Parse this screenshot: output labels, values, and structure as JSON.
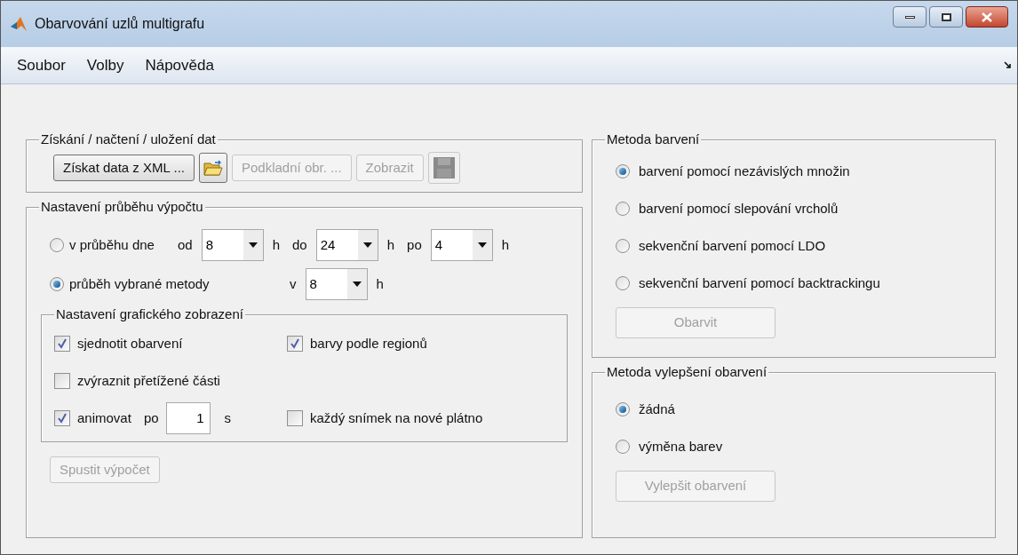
{
  "window": {
    "title": "Obarvování uzlů multigrafu"
  },
  "menu": [
    {
      "label": "Soubor"
    },
    {
      "label": "Volby"
    },
    {
      "label": "Nápověda"
    }
  ],
  "data_group": {
    "title": "Získání / načtení / uložení dat",
    "items": [
      {
        "kind": "button",
        "label": "Získat data z XML ...",
        "disabled": false
      },
      {
        "kind": "folder",
        "disabled": false
      },
      {
        "kind": "button",
        "label": "Podkladní obr. ...",
        "disabled": true
      },
      {
        "kind": "button",
        "label": "Zobrazit",
        "disabled": true
      },
      {
        "kind": "save",
        "disabled": true
      }
    ]
  },
  "calc_group": {
    "title": "Nastavení průběhu výpočtu",
    "options": [
      {
        "label": "v průběhu dne",
        "selected": false,
        "parts": [
          {
            "kind": "text",
            "text": "od"
          },
          {
            "kind": "select",
            "value": "8"
          },
          {
            "kind": "text",
            "text": "h"
          },
          {
            "kind": "text",
            "text": "do"
          },
          {
            "kind": "select",
            "value": "24"
          },
          {
            "kind": "text",
            "text": "h"
          },
          {
            "kind": "text",
            "text": "po"
          },
          {
            "kind": "select",
            "value": "4"
          },
          {
            "kind": "text",
            "text": "h"
          }
        ]
      },
      {
        "label": "průběh vybrané metody",
        "selected": true,
        "parts": [
          {
            "kind": "text",
            "text": "v"
          },
          {
            "kind": "select",
            "value": "8"
          },
          {
            "kind": "text",
            "text": "h"
          }
        ]
      }
    ],
    "graphics_group": {
      "title": "Nastavení grafického zobrazení",
      "rows": [
        [
          {
            "kind": "checkbox",
            "label": "sjednotit obarvení",
            "checked": true
          },
          {
            "kind": "checkbox",
            "label": "barvy podle regionů",
            "checked": true
          }
        ],
        [
          {
            "kind": "checkbox",
            "label": "zvýraznit přetížené části",
            "checked": false
          }
        ],
        [
          {
            "kind": "animate",
            "label": "animovat",
            "checked": true,
            "prefix": "po",
            "value": "1",
            "unit": "s"
          },
          {
            "kind": "checkbox",
            "label": "každý snímek na nové plátno",
            "checked": false
          }
        ]
      ]
    },
    "run_button": {
      "label": "Spustit výpočet",
      "disabled": true
    }
  },
  "coloring_group": {
    "title": "Metoda barvení",
    "options": [
      {
        "label": "barvení pomocí nezávislých množin",
        "selected": true
      },
      {
        "label": "barvení pomocí slepování vrcholů",
        "selected": false
      },
      {
        "label": "sekvenční barvení pomocí LDO",
        "selected": false
      },
      {
        "label": "sekvenční barvení pomocí backtrackingu",
        "selected": false
      }
    ],
    "button": {
      "label": "Obarvit",
      "disabled": true
    }
  },
  "improve_group": {
    "title": "Metoda vylepšení obarvení",
    "options": [
      {
        "label": "žádná",
        "selected": true
      },
      {
        "label": "výměna barev",
        "selected": false
      }
    ],
    "button": {
      "label": "Vylepšit obarvení",
      "disabled": true
    }
  }
}
